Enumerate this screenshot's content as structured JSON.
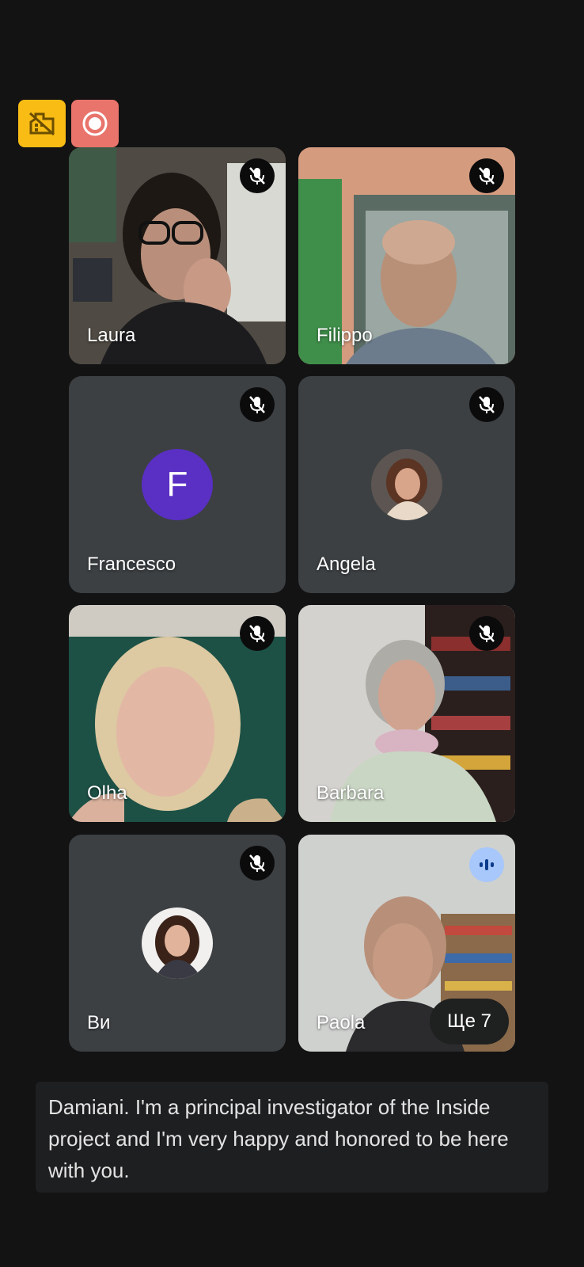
{
  "status_badges": {
    "warning_icon": "no-video-quality-icon",
    "record_icon": "recording-icon"
  },
  "participants": [
    {
      "name": "Laura",
      "muted": true,
      "type": "video"
    },
    {
      "name": "Filippo",
      "muted": true,
      "type": "video"
    },
    {
      "name": "Francesco",
      "muted": true,
      "type": "letter-avatar",
      "initial": "F"
    },
    {
      "name": "Angela",
      "muted": true,
      "type": "photo-avatar"
    },
    {
      "name": "Olha",
      "muted": true,
      "type": "video"
    },
    {
      "name": "Barbara",
      "muted": true,
      "type": "video"
    },
    {
      "name": "Ви",
      "muted": true,
      "type": "photo-avatar"
    },
    {
      "name": "Paola",
      "muted": false,
      "speaking": true,
      "type": "video"
    }
  ],
  "more_participants_label": "Ще 7",
  "caption": {
    "text": "Damiani. I'm a principal investigator of the Inside project and I'm very happy and honored to be here with you."
  },
  "colors": {
    "background": "#131314",
    "tile": "#3c4043",
    "letter_avatar": "#5a2fc4",
    "speaking": "#a8c7fa",
    "warning_badge": "#f9bc15",
    "record_badge": "#e8746b"
  }
}
